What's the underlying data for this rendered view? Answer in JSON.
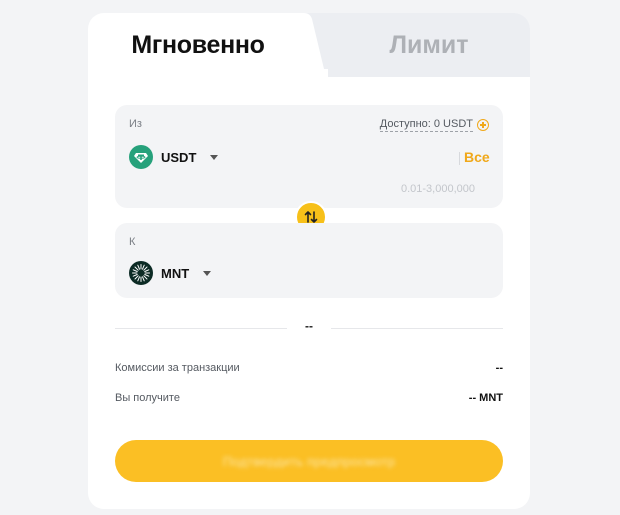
{
  "tabs": {
    "instant": "Мгновенно",
    "limit": "Лимит"
  },
  "from": {
    "label": "Из",
    "available": "Доступно: 0 USDT",
    "token": "USDT",
    "token_icon": "tether-icon",
    "amount_value": "",
    "all_label": "Все",
    "range_hint": "0.01-3,000,000"
  },
  "to": {
    "label": "К",
    "token": "MNT",
    "token_icon": "mantle-icon"
  },
  "rate": "--",
  "fees": {
    "label": "Комиссии за транзакции",
    "value": "--"
  },
  "receive": {
    "label": "Вы получите",
    "value": "-- MNT"
  },
  "confirm_button": "Подтвердить предпросмотр",
  "colors": {
    "accent": "#f7c019",
    "all_text": "#f0a81a",
    "usdt_green": "#26a17b",
    "mnt_dark": "#0c2b25"
  }
}
